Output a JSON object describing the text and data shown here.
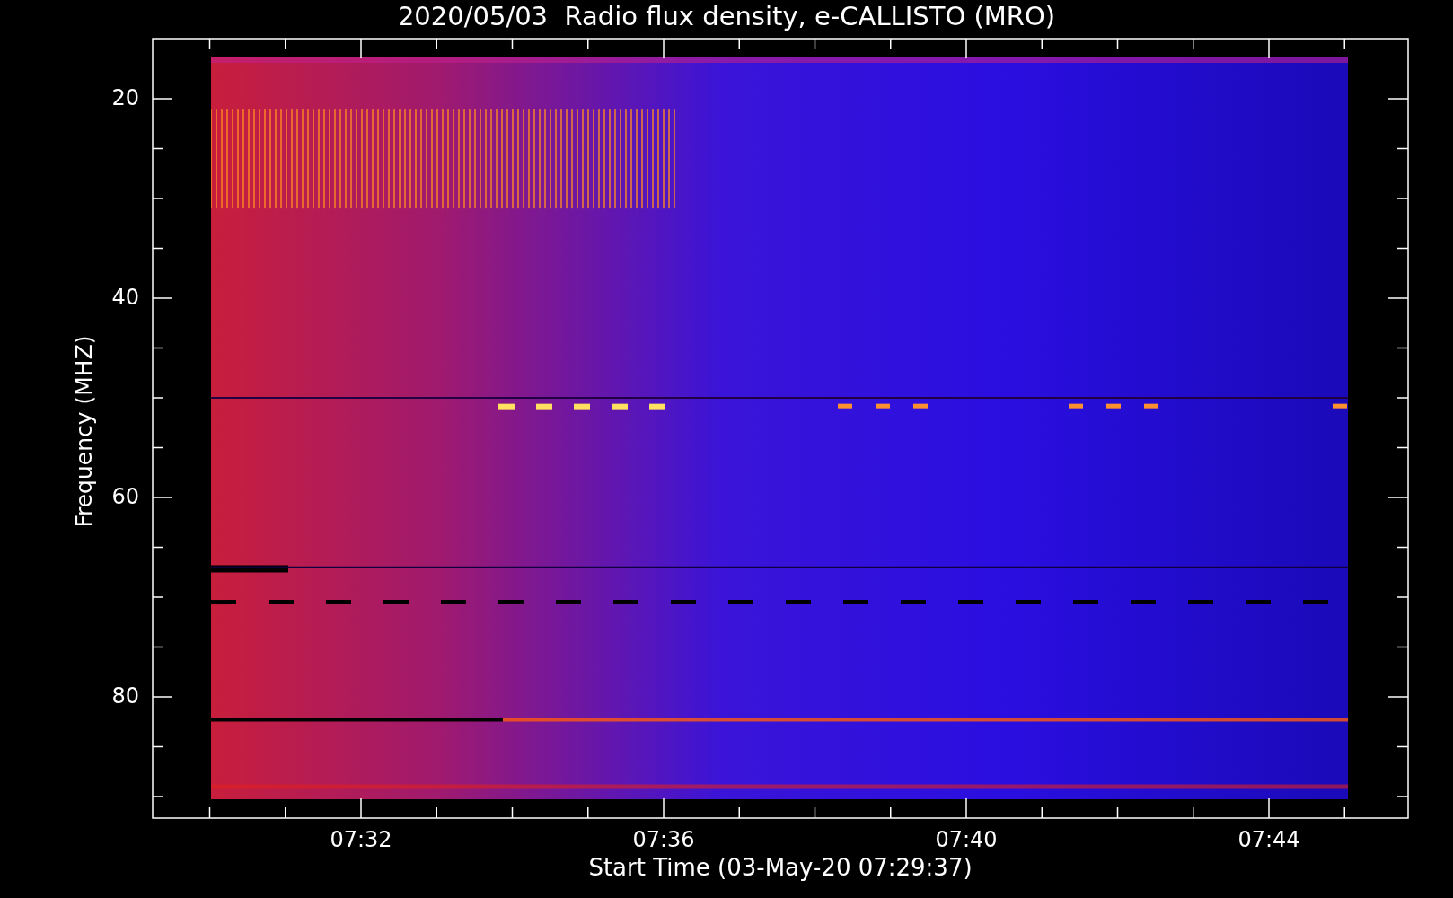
{
  "title": "2020/05/03  Radio flux density, e-CALLISTO (MRO)",
  "plot": {
    "y_axis": {
      "label": "Frequency (MHZ)",
      "ticks": [
        "20",
        "40",
        "60",
        "80"
      ]
    },
    "x_axis": {
      "label": "Start Time (03-May-20 07:29:37)",
      "ticks": [
        "07:32",
        "07:36",
        "07:40",
        "07:44"
      ]
    }
  }
}
